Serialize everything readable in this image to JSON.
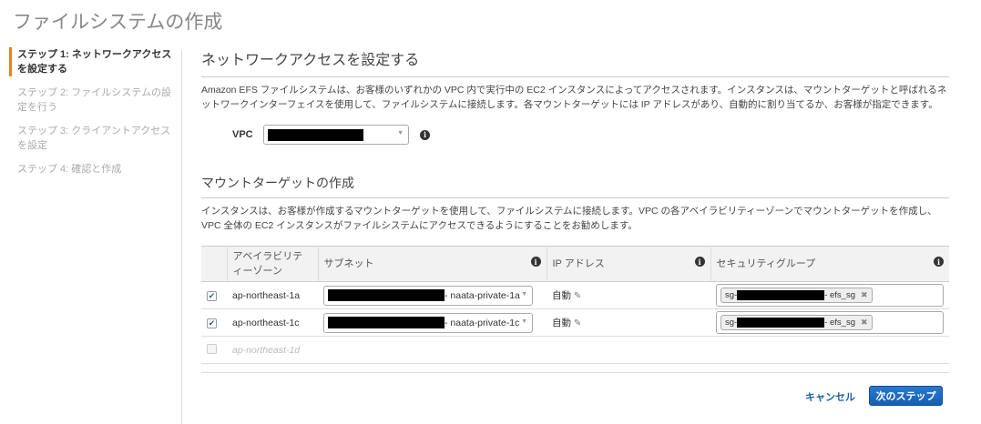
{
  "title": "ファイルシステムの作成",
  "steps": [
    {
      "label": "ステップ 1: ネットワークアクセスを設定する",
      "active": true
    },
    {
      "label": "ステップ 2: ファイルシステムの設定を行う"
    },
    {
      "label": "ステップ 3: クライアントアクセスを設定"
    },
    {
      "label": "ステップ 4: 確認と作成"
    }
  ],
  "network": {
    "heading": "ネットワークアクセスを設定する",
    "description": "Amazon EFS ファイルシステムは、お客様のいずれかの VPC 内で実行中の EC2 インスタンスによってアクセスされます。インスタンスは、マウントターゲットと呼ばれるネットワークインターフェイスを使用して、ファイルシステムに接続します。各マウントターゲットには IP アドレスがあり、自動的に割り当てるか、お客様が指定できます。",
    "vpc_label": "VPC"
  },
  "mount": {
    "heading": "マウントターゲットの作成",
    "description": "インスタンスは、お客様が作成するマウントターゲットを使用して、ファイルシステムに接続します。VPC の各アベイラビリティーゾーンでマウントターゲットを作成し、VPC 全体の EC2 インスタンスがファイルシステムにアクセスできるようにすることをお勧めします。",
    "columns": [
      "アベイラビリティーゾーン",
      "サブネット",
      "IP アドレス",
      "セキュリティグループ"
    ],
    "rows": [
      {
        "checked": true,
        "az": "ap-northeast-1a",
        "subnet_suffix": "- naata-private-1a",
        "ip": "自動",
        "sg_prefix": "sg-",
        "sg_suffix": "- efs_sg"
      },
      {
        "checked": true,
        "az": "ap-northeast-1c",
        "subnet_suffix": "- naata-private-1c",
        "ip": "自動",
        "sg_prefix": "sg-",
        "sg_suffix": "- efs_sg"
      },
      {
        "checked": false,
        "az": "ap-northeast-1d"
      }
    ]
  },
  "buttons": {
    "cancel": "キャンセル",
    "next": "次のステップ"
  }
}
